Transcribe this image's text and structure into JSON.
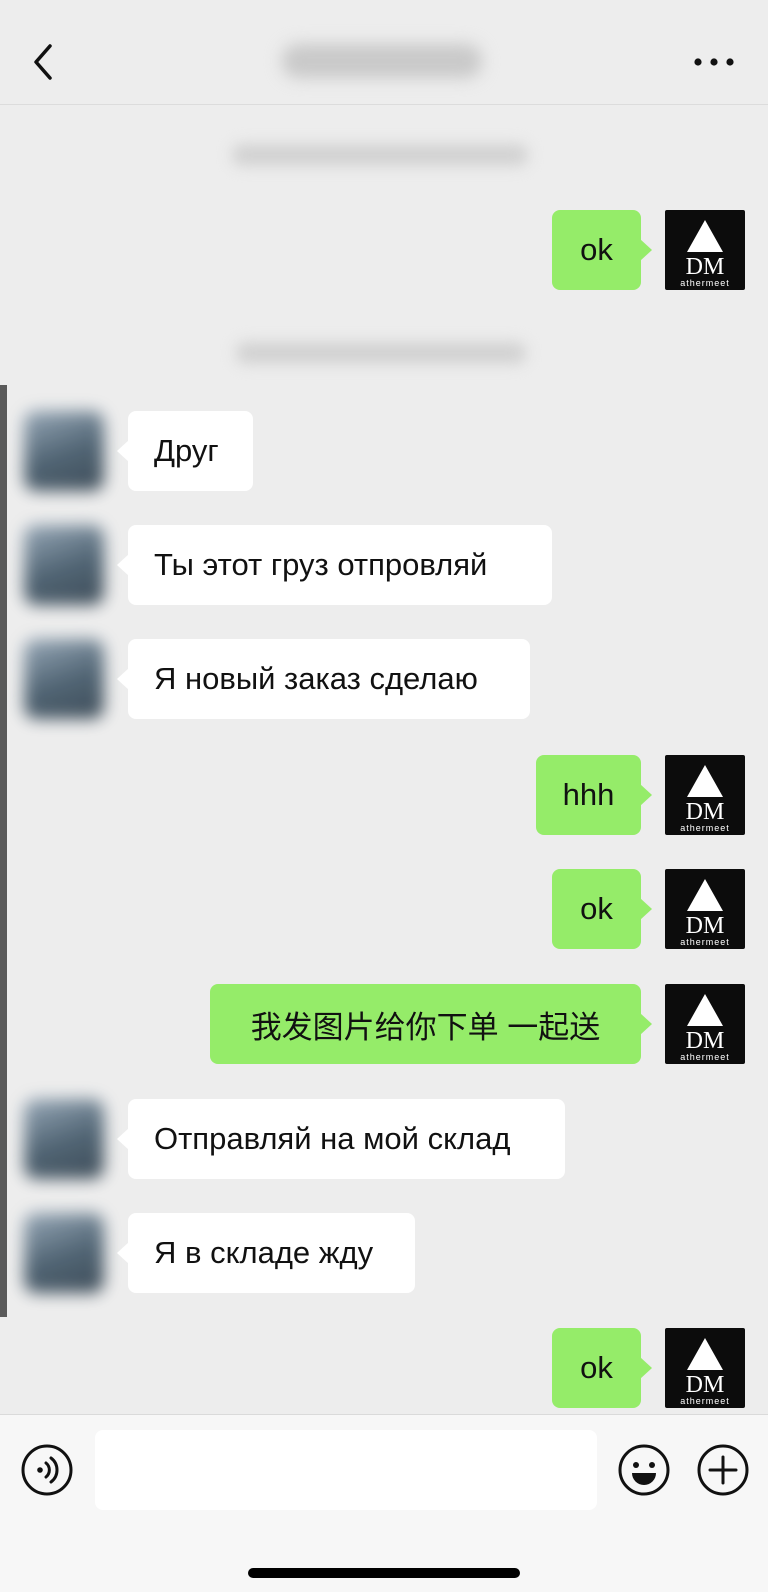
{
  "header": {
    "back_icon": "chevron-left-icon",
    "more_icon": "more-dots-icon"
  },
  "my_avatar": {
    "logo_letters": "DM",
    "logo_caption": "athermeet"
  },
  "messages": [
    {
      "side": "out",
      "text": "ok"
    },
    {
      "side": "in",
      "text": "Друг"
    },
    {
      "side": "in",
      "text": "Ты этот груз отпровляй"
    },
    {
      "side": "in",
      "text": "Я новый заказ сделаю"
    },
    {
      "side": "out",
      "text": "hhh"
    },
    {
      "side": "out",
      "text": "ok"
    },
    {
      "side": "out",
      "text": "我发图片给你下单 一起送"
    },
    {
      "side": "in",
      "text": "Отправляй на мой склад"
    },
    {
      "side": "in",
      "text": "Я в складе жду"
    },
    {
      "side": "out",
      "text": "ok"
    }
  ],
  "input_bar": {
    "value": "",
    "voice_icon": "voice-icon",
    "emoji_icon": "emoji-icon",
    "plus_icon": "plus-icon"
  },
  "colors": {
    "background": "#ededed",
    "outgoing_bubble": "#95ec69",
    "incoming_bubble": "#ffffff"
  }
}
